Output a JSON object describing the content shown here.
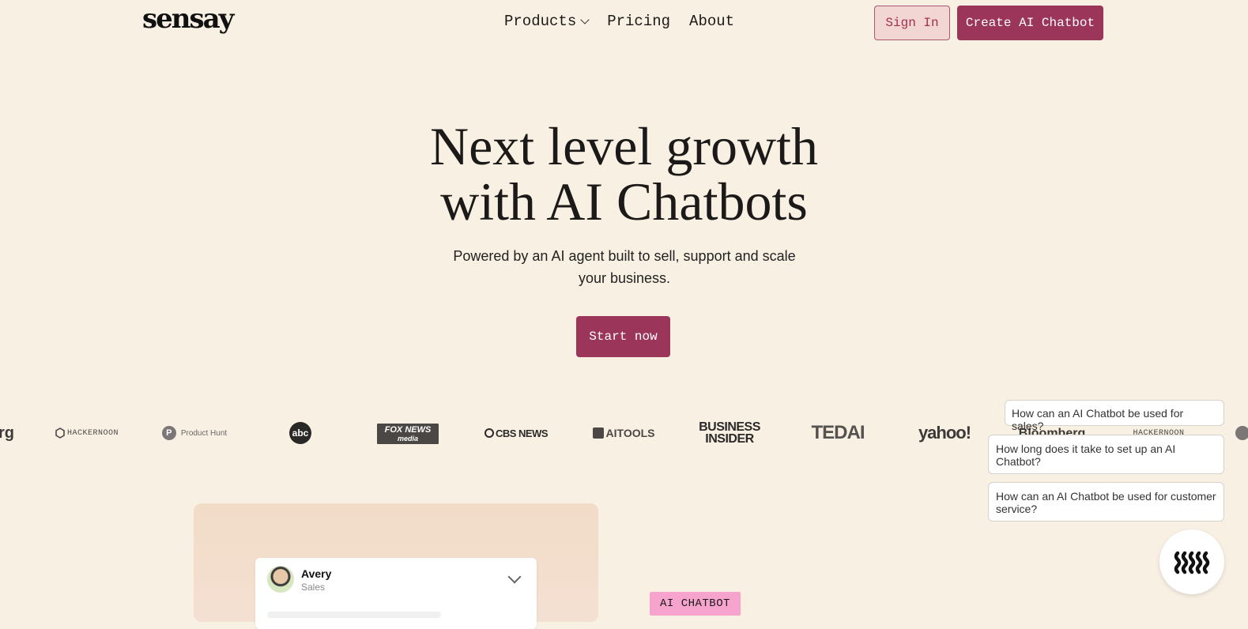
{
  "brand": {
    "logo": "sensay"
  },
  "nav": {
    "items": [
      {
        "label": "Products",
        "has_dropdown": true
      },
      {
        "label": "Pricing"
      },
      {
        "label": "About"
      }
    ],
    "sign_in": "Sign In",
    "create": "Create AI Chatbot"
  },
  "hero": {
    "title_line1": "Next level growth",
    "title_line2": "with AI Chatbots",
    "subtitle": "Powered by an AI agent built to sell, support and scale your business.",
    "cta": "Start now"
  },
  "press": [
    {
      "name": "Bloomberg",
      "partial": "rg"
    },
    {
      "name": "HackerNoon",
      "label": "HACKERNOON"
    },
    {
      "name": "Product Hunt",
      "label": "Product Hunt"
    },
    {
      "name": "abc",
      "label": "abc"
    },
    {
      "name": "Fox News Media",
      "label": "FOX NEWS",
      "sub": "media"
    },
    {
      "name": "CBS News",
      "label": "CBS NEWS"
    },
    {
      "name": "AI Tools",
      "label": "AITOOLS"
    },
    {
      "name": "Business Insider",
      "label": "BUSINESS",
      "sub": "INSIDER"
    },
    {
      "name": "TED AI",
      "label": "TEDAI"
    },
    {
      "name": "Yahoo",
      "label": "yahoo!"
    },
    {
      "name": "Bloomberg",
      "label": "Bloomberg"
    },
    {
      "name": "HackerNoon",
      "label": "HACKERNOON"
    }
  ],
  "demo": {
    "agent_name": "Avery",
    "agent_role": "Sales",
    "badge": "AI CHATBOT"
  },
  "chat_widget": {
    "suggestions": [
      "How can an AI Chatbot be used for sales?",
      "How long does it take to set up an AI Chatbot?",
      "How can an AI Chatbot be used for customer service?"
    ]
  },
  "colors": {
    "accent": "#9b3559",
    "background": "#f8f0e3",
    "chip": "#f6a4cd"
  }
}
